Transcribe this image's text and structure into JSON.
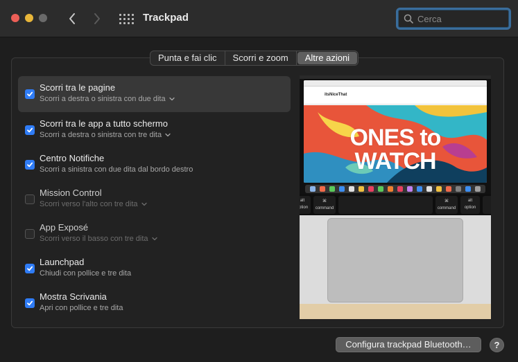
{
  "window": {
    "title": "Trackpad"
  },
  "search": {
    "placeholder": "Cerca"
  },
  "tabs": [
    {
      "label": "Punta e fai clic",
      "active": false
    },
    {
      "label": "Scorri e zoom",
      "active": false
    },
    {
      "label": "Altre azioni",
      "active": true
    }
  ],
  "gestures": [
    {
      "title": "Scorri tra le pagine",
      "subtitle": "Scorri a destra o sinistra con due dita",
      "checked": true,
      "enabled": true,
      "has_dropdown": true,
      "selected": true
    },
    {
      "title": "Scorri tra le app a tutto schermo",
      "subtitle": "Scorri a destra o sinistra con tre dita",
      "checked": true,
      "enabled": true,
      "has_dropdown": true,
      "selected": false
    },
    {
      "title": "Centro Notifiche",
      "subtitle": "Scorri a sinistra con due dita dal bordo destro",
      "checked": true,
      "enabled": true,
      "has_dropdown": false,
      "selected": false
    },
    {
      "title": "Mission Control",
      "subtitle": "Scorri verso l'alto con tre dita",
      "checked": false,
      "enabled": false,
      "has_dropdown": true,
      "selected": false
    },
    {
      "title": "App Exposé",
      "subtitle": "Scorri verso il basso con tre dita",
      "checked": false,
      "enabled": false,
      "has_dropdown": true,
      "selected": false
    },
    {
      "title": "Launchpad",
      "subtitle": "Chiudi con pollice e tre dita",
      "checked": true,
      "enabled": true,
      "has_dropdown": false,
      "selected": false
    },
    {
      "title": "Mostra Scrivania",
      "subtitle": "Apri con pollice e tre dita",
      "checked": true,
      "enabled": true,
      "has_dropdown": false,
      "selected": false
    }
  ],
  "preview": {
    "site_logo": "itsNiceThat",
    "headline_line1": "ONES to",
    "headline_line2": "WATCH",
    "keys": {
      "option": "option",
      "command": "command",
      "alt": "alt",
      "cmd_symbol": "⌘"
    }
  },
  "footer": {
    "bluetooth_button": "Configura trackpad Bluetooth…",
    "help_label": "?"
  },
  "colors": {
    "accent": "#2f7cf6",
    "search_focus": "#3a6d9c",
    "traffic_red": "#ec5f57",
    "traffic_yellow": "#e8b63a"
  },
  "icons": [
    "back-chevron-icon",
    "forward-chevron-icon",
    "grid-icon",
    "search-icon",
    "checkmark-icon",
    "chevron-down-icon"
  ]
}
